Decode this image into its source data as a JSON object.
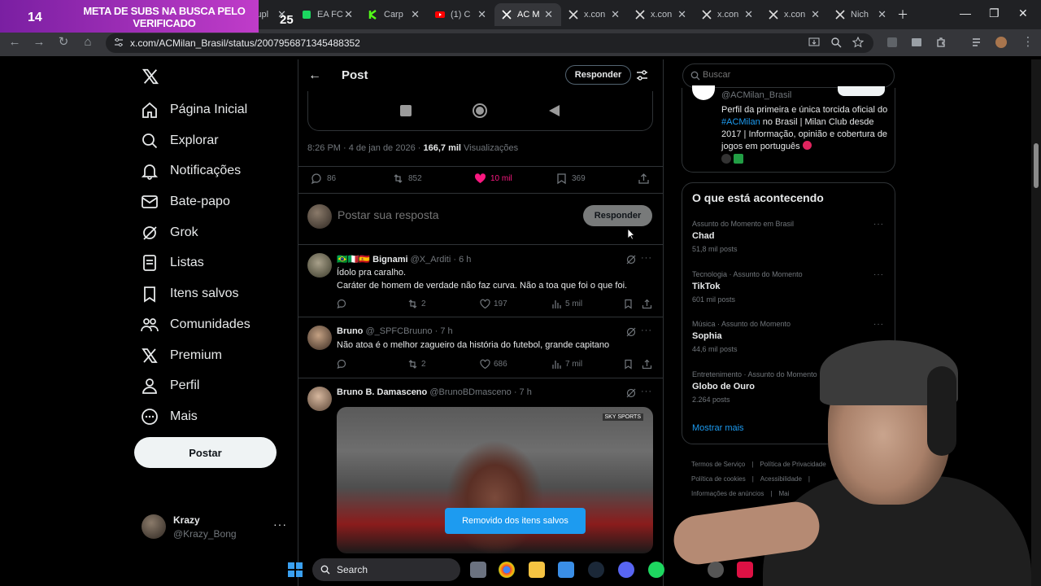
{
  "browser": {
    "overlay": {
      "number": "14",
      "text": "META DE SUBS NA BUSCA PELO VERIFICADO",
      "number2": "25"
    },
    "tabs": [
      {
        "label": "Supl",
        "icon": "globe-icon"
      },
      {
        "label": "EA FC",
        "icon": "fc-icon"
      },
      {
        "label": "Carp",
        "icon": "k-icon"
      },
      {
        "label": "(1) C",
        "icon": "youtube-icon"
      },
      {
        "label": "AC M",
        "icon": "x-icon",
        "active": true
      },
      {
        "label": "x.con",
        "icon": "x-icon"
      },
      {
        "label": "x.con",
        "icon": "x-icon"
      },
      {
        "label": "x.con",
        "icon": "x-icon"
      },
      {
        "label": "x.con",
        "icon": "x-icon"
      },
      {
        "label": "Nich",
        "icon": "x-icon"
      }
    ],
    "url": "x.com/ACMilan_Brasil/status/2007956871345488352"
  },
  "nav": {
    "items": [
      {
        "label": "Página Inicial",
        "icon": "home-icon"
      },
      {
        "label": "Explorar",
        "icon": "search-icon"
      },
      {
        "label": "Notificações",
        "icon": "bell-icon"
      },
      {
        "label": "Bate-papo",
        "icon": "mail-icon"
      },
      {
        "label": "Grok",
        "icon": "grok-icon"
      },
      {
        "label": "Listas",
        "icon": "list-icon"
      },
      {
        "label": "Itens salvos",
        "icon": "bookmark-icon"
      },
      {
        "label": "Comunidades",
        "icon": "people-icon"
      },
      {
        "label": "Premium",
        "icon": "x-icon"
      },
      {
        "label": "Perfil",
        "icon": "person-icon"
      },
      {
        "label": "Mais",
        "icon": "more-circle-icon"
      }
    ],
    "post_label": "Postar",
    "account": {
      "name": "Krazy",
      "handle": "@Krazy_Bong"
    }
  },
  "main": {
    "title": "Post",
    "reply_label": "Responder",
    "meta": {
      "time": "8:26 PM · 4 de jan de 2026 · ",
      "views": "166,7 mil",
      "views_label": " Visualizações"
    },
    "stats": {
      "replies": "86",
      "reposts": "852",
      "likes": "10 mil",
      "bookmarks": "369"
    },
    "compose": {
      "placeholder": "Postar sua resposta",
      "button": "Responder"
    },
    "replies": [
      {
        "flags": "🇧🇷🇮🇹🇪🇸",
        "name": "Bignami",
        "handle": "@X_Arditi",
        "time": "· 6 h",
        "lines": [
          "Ídolo pra caralho.",
          "Caráter de homem de verdade não faz curva. Não a toa que foi o que foi."
        ],
        "reposts": "2",
        "likes": "197",
        "views": "5 mil"
      },
      {
        "flags": "",
        "name": "Bruno",
        "handle": "@_SPFCBruuno",
        "time": "· 7 h",
        "lines": [
          "Não atoa é o melhor zagueiro da história do futebol, grande capitano"
        ],
        "reposts": "2",
        "likes": "686",
        "views": "7 mil"
      },
      {
        "flags": "",
        "name": "Bruno B. Damasceno",
        "handle": "@BrunoBDmasceno",
        "time": "· 7 h",
        "lines": [],
        "media_tag": "SKY SPORTS"
      }
    ],
    "toast": "Removido dos itens salvos"
  },
  "right": {
    "search_placeholder": "Buscar",
    "profile": {
      "handle": "@ACMilan_Brasil",
      "bio_pre": "Perfil da primeira e única torcida oficial do ",
      "bio_tag": "#ACMilan",
      "bio_post": " no Brasil | Milan Club desde 2017 | Informação, opinião e cobertura de jogos em português"
    },
    "trends_title": "O que está acontecendo",
    "trends": [
      {
        "category": "Assunto do Momento em Brasil",
        "name": "Chad",
        "count": "51,8 mil posts"
      },
      {
        "category": "Tecnologia · Assunto do Momento",
        "name": "TikTok",
        "count": "601 mil posts"
      },
      {
        "category": "Música · Assunto do Momento",
        "name": "Sophia",
        "count": "44,6 mil posts"
      },
      {
        "category": "Entretenimento · Assunto do Momento",
        "name": "Globo de Ouro",
        "count": "2.264 posts"
      }
    ],
    "show_more": "Mostrar mais",
    "footer": [
      "Termos de Serviço",
      "|",
      "Política de Privacidade",
      "|",
      "Política de cookies",
      "|",
      "Acessibilidade",
      "|",
      "Informações de anúncios",
      "|",
      "Mai"
    ]
  },
  "taskbar": {
    "search": "Search"
  }
}
